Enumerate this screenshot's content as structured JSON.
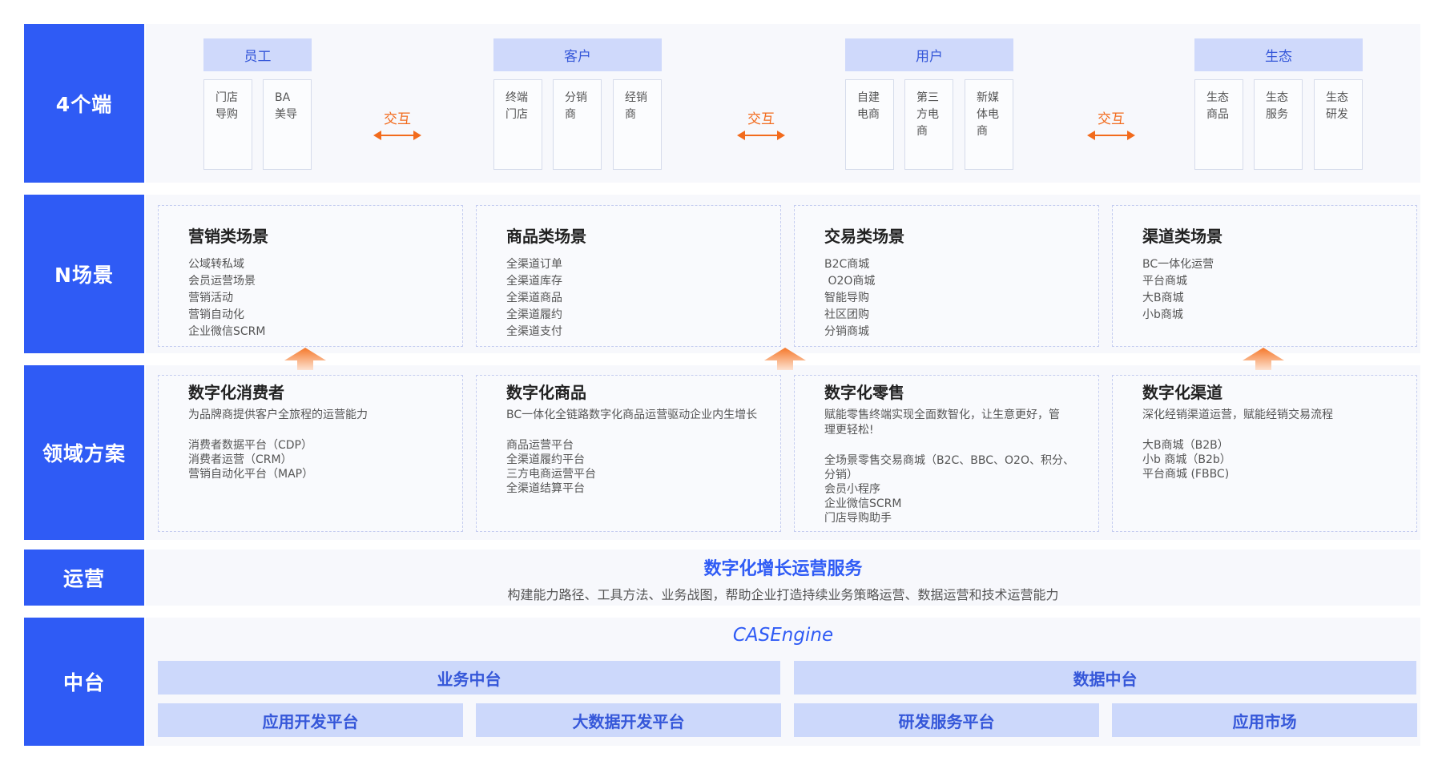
{
  "rows": {
    "endpoints": "4个端",
    "scenarios": "N场景",
    "solutions": "领域方案",
    "operations": "运营",
    "platform": "中台"
  },
  "endpoint_groups": [
    {
      "title": "员工",
      "items": [
        "门店\n导购",
        "BA\n美导"
      ]
    },
    {
      "title": "客户",
      "items": [
        "终端\n门店",
        "分销\n商",
        "经销\n商"
      ]
    },
    {
      "title": "用户",
      "items": [
        "自建\n电商",
        "第三\n方电\n商",
        "新媒\n体电\n商"
      ]
    },
    {
      "title": "生态",
      "items": [
        "生态\n商品",
        "生态\n服务",
        "生态\n研发"
      ]
    }
  ],
  "interaction_label": "交互",
  "scenarios": [
    {
      "title": "营销类场景",
      "items": [
        "公域转私域",
        "会员运营场景",
        "营销活动",
        "营销自动化",
        "企业微信SCRM"
      ]
    },
    {
      "title": "商品类场景",
      "items": [
        "全渠道订单",
        "全渠道库存",
        "全渠道商品",
        "全渠道履约",
        "全渠道支付"
      ]
    },
    {
      "title": "交易类场景",
      "items": [
        "B2C商城",
        " O2O商城",
        "智能导购",
        "社区团购",
        "分销商城"
      ]
    },
    {
      "title": "渠道类场景",
      "items": [
        "BC一体化运营",
        "平台商城",
        "大B商城",
        "小b商城"
      ]
    }
  ],
  "solutions": [
    {
      "title": "数字化消费者",
      "subtitle": "为品牌商提供客户全旅程的运营能力",
      "items": [
        "消费者数据平台（CDP）",
        "消费者运营（CRM）",
        "营销自动化平台（MAP）"
      ]
    },
    {
      "title": "数字化商品",
      "subtitle": "BC一体化全链路数字化商品运营驱动企业内生增长",
      "items": [
        "商品运营平台",
        "全渠道履约平台",
        "三方电商运营平台",
        "全渠道结算平台"
      ]
    },
    {
      "title": "数字化零售",
      "subtitle": "赋能零售终端实现全面数智化，让生意更好，管\n理更轻松!",
      "items": [
        "全场景零售交易商城（B2C、BBC、O2O、积分、",
        "分销）",
        "会员小程序",
        "企业微信SCRM",
        "门店导购助手"
      ]
    },
    {
      "title": "数字化渠道",
      "subtitle": "深化经销渠道运营，赋能经销交易流程",
      "items": [
        "大B商城（B2B）",
        "小b 商城（B2b）",
        "平台商城 (FBBC)"
      ]
    }
  ],
  "operations": {
    "title": "数字化增长运营服务",
    "subtitle": "构建能力路径、工具方法、业务战图，帮助企业打造持续业务策略运营、数据运营和技术运营能力"
  },
  "platform": {
    "engine": "CASEngine",
    "business": "业务中台",
    "data": "数据中台",
    "modules": [
      "应用开发平台",
      "大数据开发平台",
      "研发服务平台",
      "应用市场"
    ]
  },
  "colors": {
    "primary": "#2f5bf5",
    "light_band": "#ccd8fb",
    "accent_orange": "#f26b1d"
  }
}
